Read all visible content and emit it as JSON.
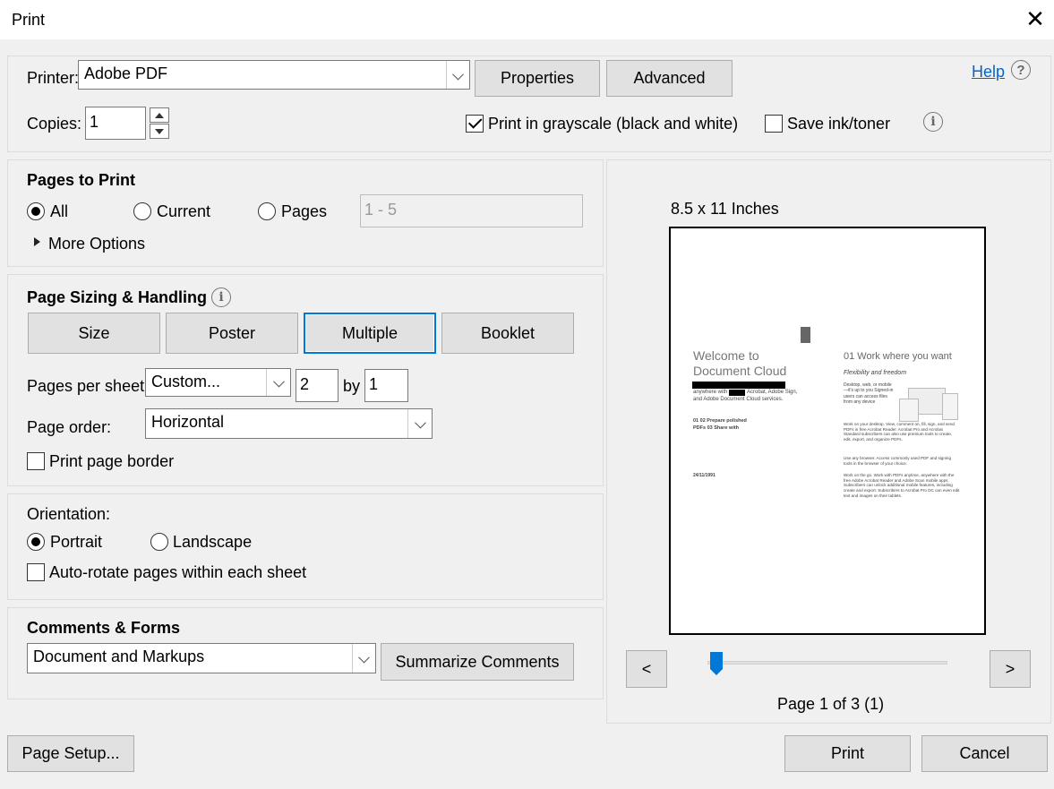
{
  "window": {
    "title": "Print",
    "close_glyph": "✕"
  },
  "printer": {
    "label": "Printer:",
    "selected": "Adobe PDF",
    "properties_label": "Properties",
    "advanced_label": "Advanced",
    "help_label": "Help",
    "help_glyph": "?"
  },
  "copies": {
    "label": "Copies:",
    "value": "1",
    "grayscale_label": "Print in grayscale (black and white)",
    "grayscale_checked": true,
    "save_ink_label": "Save ink/toner",
    "save_ink_checked": false,
    "info_glyph": "i"
  },
  "pages_to_print": {
    "heading": "Pages to Print",
    "all_label": "All",
    "current_label": "Current",
    "pages_label": "Pages",
    "selected": "All",
    "range_value": "1 - 5",
    "more_options_label": "More Options"
  },
  "sizing": {
    "heading": "Page Sizing & Handling",
    "info_glyph": "i",
    "size_label": "Size",
    "poster_label": "Poster",
    "multiple_label": "Multiple",
    "booklet_label": "Booklet",
    "selected": "Multiple",
    "pages_per_sheet_label": "Pages per sheet:",
    "pages_per_sheet_value": "Custom...",
    "cols_value": "2",
    "by_label": "by",
    "rows_value": "1",
    "page_order_label": "Page order:",
    "page_order_value": "Horizontal",
    "print_border_label": "Print page border",
    "print_border_checked": false
  },
  "orientation": {
    "heading": "Orientation:",
    "portrait_label": "Portrait",
    "landscape_label": "Landscape",
    "selected": "Portrait",
    "autorotate_label": "Auto-rotate pages within each sheet",
    "autorotate_checked": false
  },
  "comments": {
    "heading": "Comments & Forms",
    "value": "Document and Markups",
    "summarize_label": "Summarize Comments"
  },
  "preview": {
    "size_label": "8.5 x 11 Inches",
    "prev_label": "<",
    "next_label": ">",
    "page_label": "Page 1 of 3 (1)",
    "slider_position": 0,
    "thumb": {
      "left_title_1": "Welcome to",
      "left_title_2": "Document Cloud",
      "left_line_1": "anywhere with",
      "left_line_1b": "Acrobat, Adobe Sign,",
      "left_line_2": "and Adobe Document Cloud services.",
      "left_toc_1": "01   02  Prepare polished",
      "left_toc_2": "PDFs 03  Share with",
      "left_date": "24/11/1991",
      "right_heading": "01 Work where you want",
      "right_sub": "Flexibility and freedom",
      "right_p1": "Desktop, web, or mobile—it's up to you Signed-in users can access files from any device",
      "right_p2": "Work on your desktop. View, comment on, fill, sign, and send PDFs in free Acrobat Reader. Acrobat Pro and Acrobat Standard subscribers can also use premium tools to create, edit, export, and organize PDFs.",
      "right_p3": "Use any browser. Access commonly used PDF and signing tools in the browser of your choice.",
      "right_p4": "Work on the go. Work with PDFs anytime, anywhere with the free Adobe Acrobat Reader and Adobe Scan mobile apps. Subscribers can unlock additional mobile features, including create and export. Subscribers to Acrobat Pro DC can even edit text and images on their tablets."
    }
  },
  "footer": {
    "page_setup_label": "Page Setup...",
    "print_label": "Print",
    "cancel_label": "Cancel"
  }
}
